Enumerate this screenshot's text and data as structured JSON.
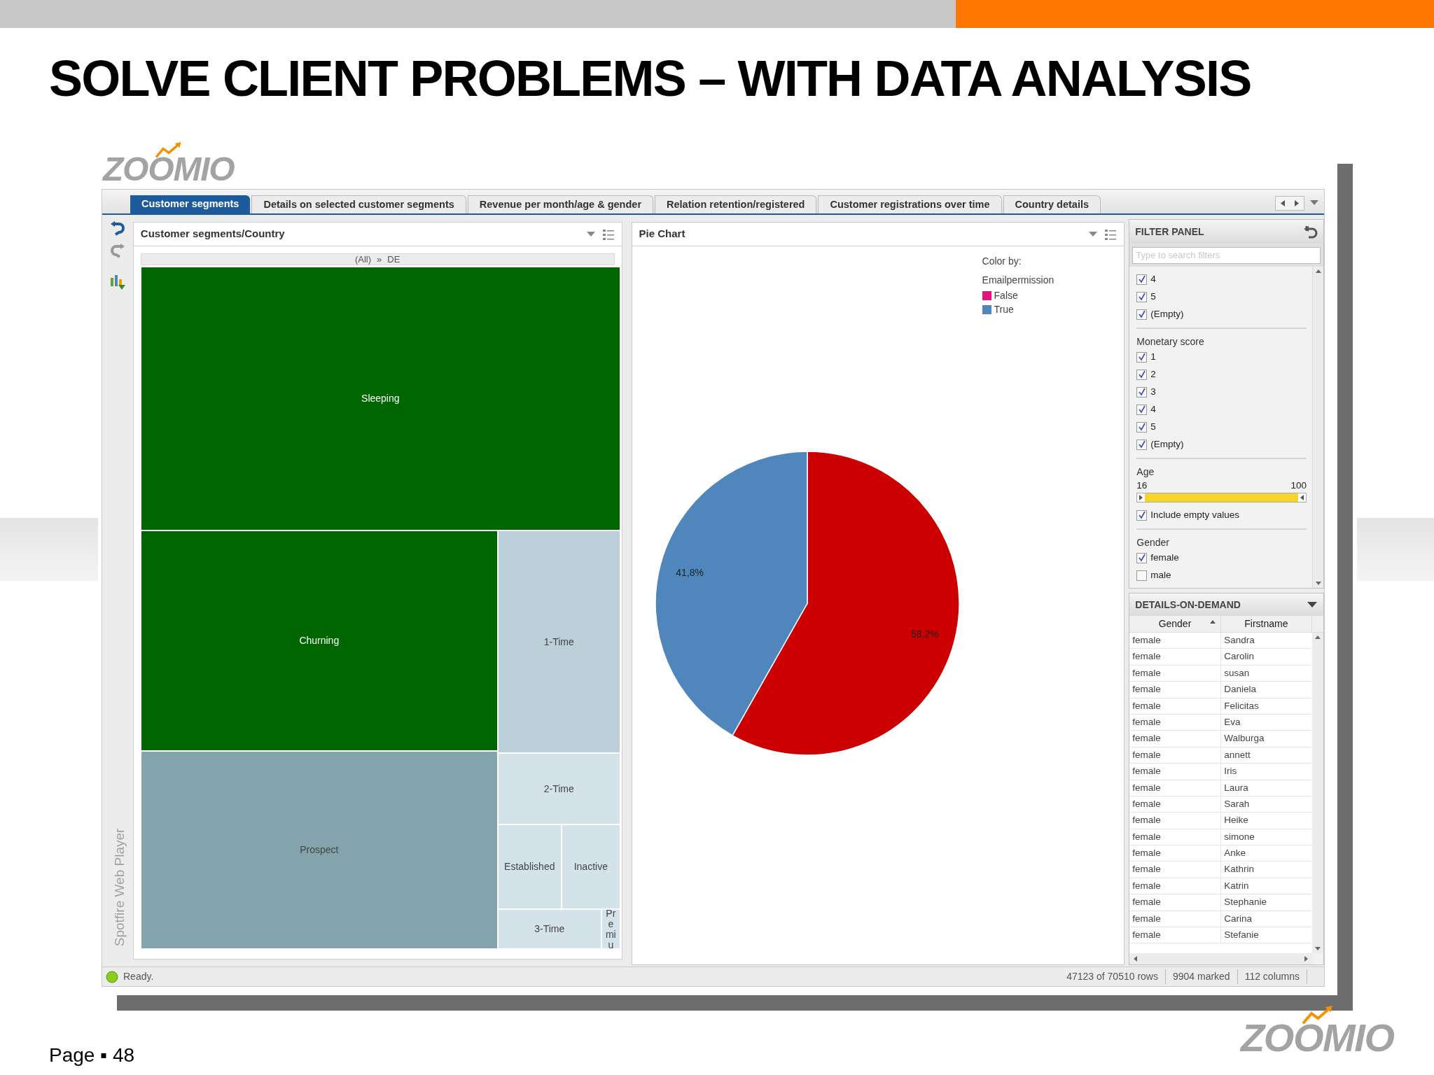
{
  "slide": {
    "title": "SOLVE CLIENT PROBLEMS – WITH DATA ANALYSIS",
    "logo": "ZOOMIO",
    "page": "Page ▪ 48",
    "footer_logo": "ZOOMIO"
  },
  "app": {
    "side_label": "Spotfire Web Player",
    "tabs": [
      {
        "label": "Customer segments",
        "selected": true
      },
      {
        "label": "Details on selected customer segments",
        "selected": false
      },
      {
        "label": "Revenue per month/age & gender",
        "selected": false
      },
      {
        "label": "Relation retention/registered",
        "selected": false
      },
      {
        "label": "Customer registrations over time",
        "selected": false
      },
      {
        "label": "Country details",
        "selected": false
      }
    ],
    "treemap": {
      "title": "Customer segments/Country",
      "breadcrumb_all": "(All)",
      "breadcrumb_sep": "»",
      "breadcrumb_item": "DE",
      "tiles": [
        {
          "label": "Sleeping",
          "color": "#006600"
        },
        {
          "label": "Churning",
          "color": "#006600"
        },
        {
          "label": "Prospect",
          "color": "#83a4ad"
        },
        {
          "label": "1-Time",
          "color": "#bacfd8"
        },
        {
          "label": "2-Time",
          "color": "#d4e2ea"
        },
        {
          "label": "Established",
          "color": "#d4e2ea"
        },
        {
          "label": "Inactive",
          "color": "#d4e2ea"
        },
        {
          "label": "3-Time",
          "color": "#d4e2ea"
        },
        {
          "label": "Premiu",
          "color": "#d4e2ea"
        }
      ]
    },
    "pie": {
      "title": "Pie Chart",
      "legend_title": "Color by:",
      "legend": [
        {
          "color": "#e8107a"
        },
        {
          "color": "#4f87bd"
        }
      ],
      "chart_data": {
        "type": "pie",
        "categories": [
          "False",
          "True"
        ],
        "series": [
          {
            "name": "Emailpermission",
            "values": [
              58.2,
              41.8
            ]
          }
        ],
        "colors": [
          "#cc0000",
          "#4f87bd"
        ],
        "value_labels": [
          "58,2%",
          "41,8%"
        ]
      }
    },
    "filter_panel": {
      "title": "FILTER PANEL",
      "placeholder": "Type to search filters",
      "groups": [
        {
          "kind": "checklist",
          "items": [
            {
              "label": "4",
              "checked": true
            },
            {
              "label": "5",
              "checked": true
            },
            {
              "label": "(Empty)",
              "checked": true
            }
          ]
        },
        {
          "kind": "checklist",
          "title": "Monetary score",
          "items": [
            {
              "label": "1",
              "checked": true
            },
            {
              "label": "2",
              "checked": true
            },
            {
              "label": "3",
              "checked": true
            },
            {
              "label": "4",
              "checked": true
            },
            {
              "label": "5",
              "checked": true
            },
            {
              "label": "(Empty)",
              "checked": true
            }
          ]
        },
        {
          "kind": "range",
          "title": "Age",
          "min": "16",
          "max": "100",
          "level": 1,
          "items": [
            {
              "label": "Include empty values",
              "checked": true
            }
          ]
        },
        {
          "kind": "checklist",
          "title": "Gender",
          "items": [
            {
              "label": "female",
              "checked": true
            },
            {
              "label": "male",
              "checked": false
            }
          ]
        }
      ]
    },
    "details": {
      "title": "DETAILS-ON-DEMAND",
      "columns": [
        {
          "label": "Gender",
          "sorted": true
        },
        {
          "label": "Firstname",
          "sorted": false
        }
      ],
      "rows": [
        [
          "female",
          "Sandra"
        ],
        [
          "female",
          "Carolin"
        ],
        [
          "female",
          "susan"
        ],
        [
          "female",
          "Daniela"
        ],
        [
          "female",
          "Felicitas"
        ],
        [
          "female",
          "Eva"
        ],
        [
          "female",
          "Walburga"
        ],
        [
          "female",
          "annett"
        ],
        [
          "female",
          "Iris"
        ],
        [
          "female",
          "Laura"
        ],
        [
          "female",
          "Sarah"
        ],
        [
          "female",
          "Heike"
        ],
        [
          "female",
          "simone"
        ],
        [
          "female",
          "Anke"
        ],
        [
          "female",
          "Kathrin"
        ],
        [
          "female",
          "Katrin"
        ],
        [
          "female",
          "Stephanie"
        ],
        [
          "female",
          "Carina"
        ],
        [
          "female",
          "Stefanie"
        ]
      ]
    },
    "status": {
      "text": "Ready.",
      "rows": "47123 of 70510 rows",
      "marked": "9904 marked",
      "columns": "112 columns"
    }
  }
}
